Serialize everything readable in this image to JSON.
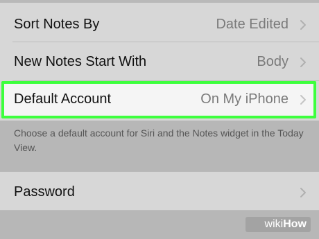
{
  "settings": {
    "rows": [
      {
        "label": "Sort Notes By",
        "value": "Date Edited"
      },
      {
        "label": "New Notes Start With",
        "value": "Body"
      },
      {
        "label": "Default Account",
        "value": "On My iPhone"
      },
      {
        "label": "Password",
        "value": ""
      }
    ],
    "footer": "Choose a default account for Siri and the Notes widget in the Today View."
  },
  "watermark": {
    "wiki": "wiki",
    "how": "How"
  },
  "colors": {
    "highlight": "#3dff3d",
    "background": "#b7b7b7",
    "row_background": "#d7d7d7",
    "value_text": "#7a7a7a"
  },
  "icons": {
    "chevron": "chevron-right-icon"
  }
}
